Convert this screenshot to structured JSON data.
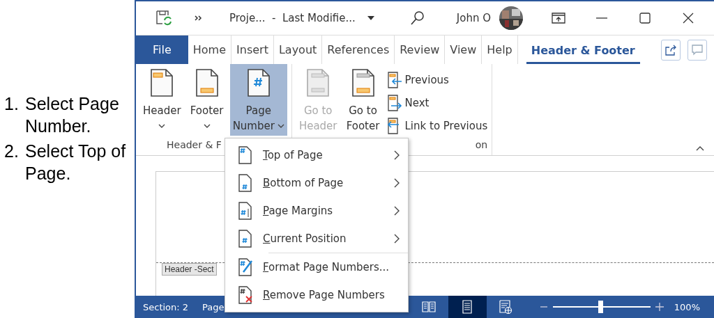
{
  "instructions": [
    {
      "number": "1.",
      "text": "Select Page Number."
    },
    {
      "number": "2.",
      "text": "Select Top of Page."
    }
  ],
  "title_bar": {
    "document_title": "Proje...  -  Last Modifie...",
    "user": "John O"
  },
  "tabs": [
    {
      "label": "File",
      "kind": "file",
      "selected": false
    },
    {
      "label": "Home",
      "kind": "tab",
      "selected": false
    },
    {
      "label": "Insert",
      "kind": "tab",
      "selected": false
    },
    {
      "label": "Layout",
      "kind": "tab",
      "selected": false
    },
    {
      "label": "References",
      "kind": "tab",
      "selected": false
    },
    {
      "label": "Review",
      "kind": "tab",
      "selected": false
    },
    {
      "label": "View",
      "kind": "tab",
      "selected": false
    },
    {
      "label": "Help",
      "kind": "tab",
      "selected": false
    },
    {
      "label": "Header & Footer",
      "kind": "tab",
      "selected": true
    }
  ],
  "ribbon": {
    "groups": [
      {
        "label": "Header & F",
        "buttons": [
          {
            "kind": "header",
            "lines": [
              "Header"
            ],
            "selected": false,
            "disabled": false
          },
          {
            "kind": "footer",
            "lines": [
              "Footer"
            ],
            "selected": false,
            "disabled": false
          },
          {
            "kind": "page-number",
            "lines": [
              "Page",
              "Number"
            ],
            "selected": true,
            "disabled": false
          }
        ]
      },
      {
        "label": "on",
        "buttons": [
          {
            "kind": "go-header",
            "lines": [
              "Go to",
              "Header"
            ],
            "selected": false,
            "disabled": true
          },
          {
            "kind": "go-footer",
            "lines": [
              "Go to",
              "Footer"
            ],
            "selected": false,
            "disabled": false
          }
        ],
        "small_buttons": [
          {
            "kind": "previous",
            "label": "Previous"
          },
          {
            "kind": "next",
            "label": "Next"
          },
          {
            "kind": "link",
            "label": "Link to Previous"
          }
        ]
      }
    ]
  },
  "document": {
    "section_tag": "Header -Sect"
  },
  "menu": {
    "sections": [
      {
        "items": [
          {
            "kind": "top",
            "label": "Top of Page",
            "submenu": true
          },
          {
            "kind": "bottom",
            "label": "Bottom of Page",
            "submenu": true
          },
          {
            "kind": "margins",
            "label": "Page Margins",
            "submenu": true
          },
          {
            "kind": "current",
            "label": "Current Position",
            "submenu": true
          }
        ]
      },
      {
        "items": [
          {
            "kind": "format",
            "label": "Format Page Numbers...",
            "submenu": false
          },
          {
            "kind": "remove",
            "label": "Remove Page Numbers",
            "submenu": false
          }
        ]
      }
    ]
  },
  "status_bar": {
    "section": "Section: 2",
    "page": "Page",
    "views": [
      {
        "kind": "read",
        "selected": false
      },
      {
        "kind": "print",
        "selected": true
      },
      {
        "kind": "web",
        "selected": false
      }
    ],
    "zoom": {
      "level": 0.49,
      "reading": "100%"
    }
  }
}
